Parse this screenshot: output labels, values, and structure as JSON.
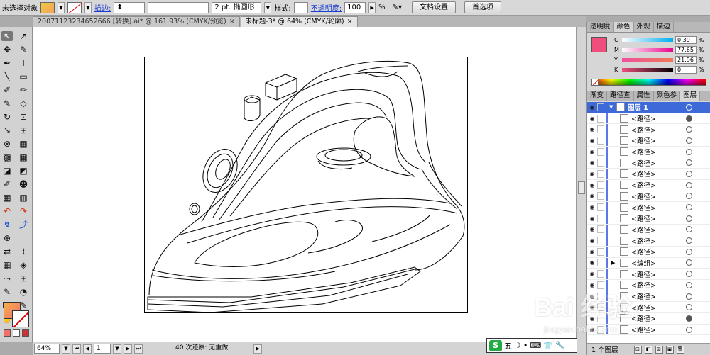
{
  "control_bar": {
    "selection_label": "未选择对象",
    "stroke_label": "描边:",
    "stroke_profile": "2 pt. 椭圆形",
    "style_label": "样式:",
    "opacity_label": "不透明度:",
    "opacity_value": "100",
    "opacity_unit": "%",
    "doc_setup_button": "文档设置",
    "preferences_button": "首选项",
    "fill_color": "#f4a35a",
    "icons": [
      "fill-swatch",
      "stroke-none-swatch",
      "brush-icon"
    ]
  },
  "tabs": [
    {
      "label": "20071123234652666 [转换].ai* @ 161.93% (CMYK/预览)",
      "close": "×",
      "active": false
    },
    {
      "label": "未标题-3* @ 64% (CMYK/轮廓)",
      "close": "×",
      "active": true
    }
  ],
  "tools": {
    "glyphs": [
      "↖",
      "↗",
      "✥",
      "✎",
      "✒",
      "T",
      "╲",
      "▭",
      "✐",
      "✏",
      "✎",
      "◇",
      "↻",
      "⊡",
      "↘",
      "⊞",
      "⊗",
      "▦",
      "▩",
      "▦",
      "◪",
      "◩",
      "✐",
      "☻",
      "▦",
      "▥",
      "↶",
      "↷",
      "↯",
      "⤴",
      "⊕",
      "",
      "⇄",
      "⌇",
      "▦",
      "◈",
      "⤳",
      "⊞",
      "✎",
      "◔",
      "⌧",
      "✎",
      "✋",
      "🔍"
    ],
    "names": [
      "selection-tool-icon",
      "direct-selection-tool-icon",
      "magic-wand-icon",
      "lasso-icon",
      "pen-tool-icon",
      "type-tool-icon",
      "line-tool-icon",
      "rectangle-tool-icon",
      "paintbrush-icon",
      "pencil-icon",
      "blob-brush-icon",
      "eraser-icon",
      "rotate-tool-icon",
      "scale-tool-icon",
      "warp-tool-icon",
      "free-transform-icon",
      "shape-builder-icon",
      "perspective-grid-icon",
      "mesh-tool-icon",
      "gradient-tool-icon",
      "eyedropper-icon",
      "blend-tool-icon",
      "symbol-sprayer-icon",
      "column-graph-icon",
      "artboard-tool-icon",
      "slice-tool-icon",
      "undo-arrow-icon",
      "redo-arrow-icon",
      "path-arrow-icon",
      "reshape-arrow-icon",
      "crosshair-icon",
      "blank-icon",
      "mirror-tool-icon",
      "wave-tool-icon",
      "grid-tool-icon",
      "perspective-tool-icon",
      "graph-tool-icon",
      "chart-tool-icon",
      "knife-tool-icon",
      "scissors-icon",
      "zoom-fit-icon",
      "measure-tool-icon",
      "hand-tool-icon",
      "zoom-tool-icon"
    ],
    "fill_gradient": [
      "#f6b04a",
      "#f2706a"
    ],
    "mini_swatches": [
      "#f2706a",
      "#ffffff",
      "#cc3333"
    ]
  },
  "status": {
    "zoom": "64%",
    "page": "1",
    "history": "40 次还原: 无重做"
  },
  "color_panel": {
    "tabs": [
      "透明度",
      "颜色",
      "外观",
      "描边"
    ],
    "active_tab": "颜色",
    "swatch": "#f04f7d",
    "channels": [
      {
        "label": "C",
        "value": "0.39",
        "unit": "%",
        "bar": "linear-gradient(90deg,#fff,#00aeef)"
      },
      {
        "label": "M",
        "value": "77.65",
        "unit": "%",
        "bar": "linear-gradient(90deg,#fff,#ec008c)"
      },
      {
        "label": "Y",
        "value": "21.96",
        "unit": "%",
        "bar": "linear-gradient(90deg,#f04f9d,#f07a55)"
      },
      {
        "label": "K",
        "value": "0",
        "unit": "%",
        "bar": "linear-gradient(90deg,#f04f7d,#000)"
      }
    ]
  },
  "layers_panel": {
    "tabs": [
      "渐变",
      "路径查",
      "属性",
      "颜色参",
      "图层"
    ],
    "active_tab": "图层",
    "top_layer": "图层 1",
    "items": [
      {
        "name": "<路径>",
        "filled": true
      },
      {
        "name": "<路径>",
        "filled": false
      },
      {
        "name": "<路径>",
        "filled": false
      },
      {
        "name": "<路径>",
        "filled": false
      },
      {
        "name": "<路径>",
        "filled": false
      },
      {
        "name": "<路径>",
        "filled": false
      },
      {
        "name": "<路径>",
        "filled": false
      },
      {
        "name": "<路径>",
        "filled": false
      },
      {
        "name": "<路径>",
        "filled": false
      },
      {
        "name": "<路径>",
        "filled": false
      },
      {
        "name": "<路径>",
        "filled": false
      },
      {
        "name": "<路径>",
        "filled": false
      },
      {
        "name": "<路径>",
        "filled": false
      },
      {
        "name": "<编组>",
        "filled": false,
        "group": true
      },
      {
        "name": "<路径>",
        "filled": false
      },
      {
        "name": "<路径>",
        "filled": false
      },
      {
        "name": "<路径>",
        "filled": false
      },
      {
        "name": "<路径>",
        "filled": false
      },
      {
        "name": "<路径>",
        "filled": true
      },
      {
        "name": "<路径>",
        "filled": false
      }
    ],
    "footer": "1 个图层"
  },
  "ime": {
    "logo": "S",
    "mode": "五",
    "glyphs": [
      "☽",
      "•",
      "⌨",
      "👕",
      "🔧"
    ]
  },
  "watermark": {
    "brand": "Bai 经验",
    "url": "jingyan.baidu.com"
  }
}
